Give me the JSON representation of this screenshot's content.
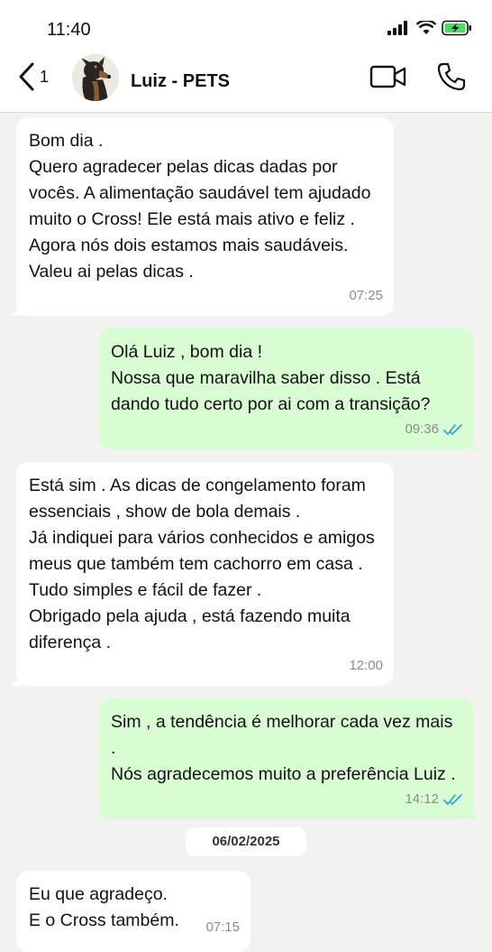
{
  "status_bar": {
    "time": "11:40",
    "icons": [
      "signal-icon",
      "wifi-icon",
      "battery-charging-icon"
    ]
  },
  "header": {
    "back_count": "1",
    "contact_name": "Luiz - PETS",
    "avatar": "dog-avatar",
    "actions": [
      "video-call-icon",
      "phone-icon"
    ]
  },
  "colors": {
    "incoming_bubble": "#ffffff",
    "outgoing_bubble": "#d9fdd3",
    "read_ticks": "#34a3e0",
    "background": "#f2f2f0"
  },
  "messages": [
    {
      "direction": "in",
      "text": "Bom dia .\nQuero agradecer pelas dicas dadas por vocês. A alimentação saudável tem ajudado muito o Cross! Ele está mais ativo e feliz .\nAgora nós dois estamos mais saudáveis.\nValeu ai pelas dicas .",
      "time": "07:25"
    },
    {
      "direction": "out",
      "text": "Olá Luiz , bom dia !\nNossa que maravilha saber disso . Está dando tudo certo por ai com a transição?",
      "time": "09:36",
      "status": "read"
    },
    {
      "direction": "in",
      "text": "Está sim . As dicas de congelamento foram essenciais , show de bola demais .\nJá indiquei para vários conhecidos e amigos meus que também tem cachorro em casa .\nTudo simples e fácil de fazer .\nObrigado pela ajuda , está fazendo muita diferença .",
      "time": "12:00"
    },
    {
      "direction": "out",
      "text": "Sim , a tendência é melhorar cada vez mais .\nNós agradecemos muito a preferência Luiz .",
      "time": "14:12",
      "status": "read"
    },
    {
      "direction": "in",
      "text": "Eu que agradeço.\nE o Cross também.",
      "time": "07:15"
    }
  ],
  "date_separator": "06/02/2025"
}
